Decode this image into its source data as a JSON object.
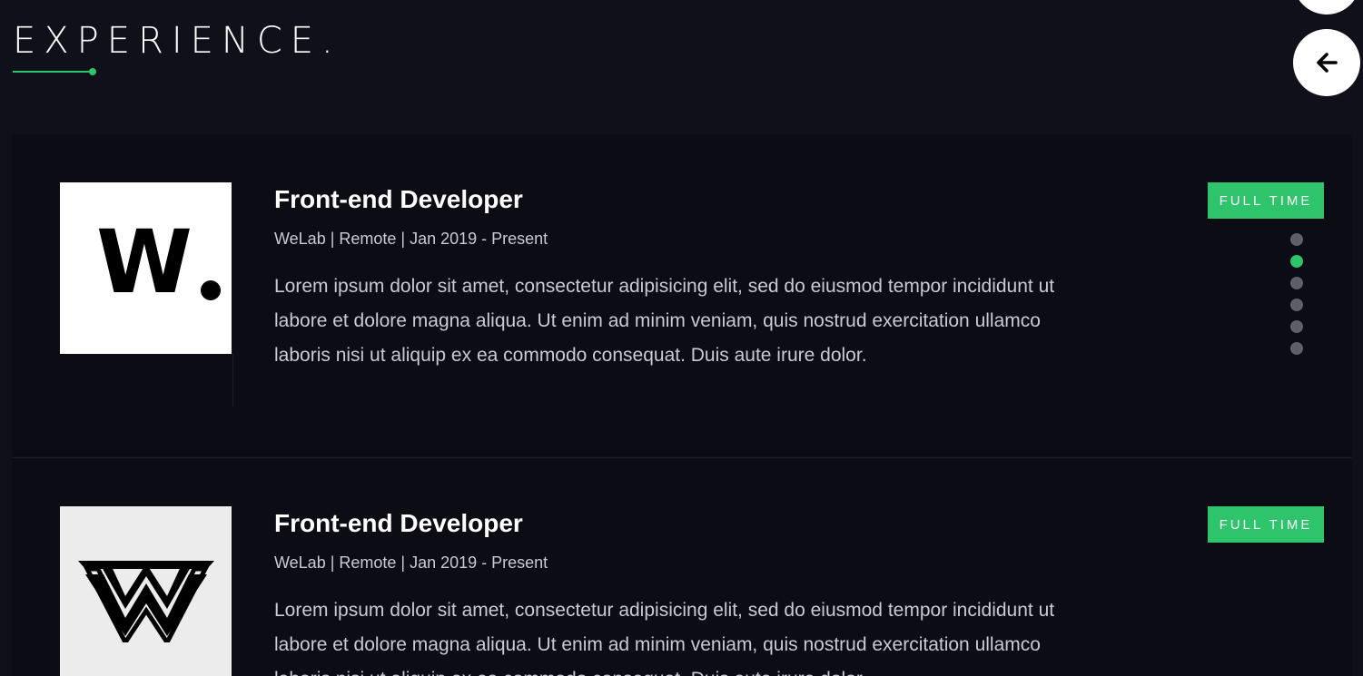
{
  "section": {
    "title": "EXPERIENCE."
  },
  "nav": {
    "top_button_icon": "circle-button",
    "back_button_icon": "arrow-left-icon"
  },
  "experience": [
    {
      "logo_icon": "welab-logo",
      "logo_text": "W",
      "title": "Front-end Developer",
      "meta": "WeLab | Remote | Jan 2019 - Present",
      "description": "Lorem ipsum dolor sit amet, consectetur adipisicing elit, sed do eiusmod tempor incididunt ut labore et dolore magna aliqua. Ut enim ad minim veniam, quis nostrud exercitation ullamco laboris nisi ut aliquip ex ea commodo consequat. Duis aute irure dolor.",
      "badge": "FULL TIME"
    },
    {
      "logo_icon": "wonder-woman-w-logo",
      "title": "Front-end Developer",
      "meta": "WeLab | Remote | Jan 2019 - Present",
      "description": "Lorem ipsum dolor sit amet, consectetur adipisicing elit, sed do eiusmod tempor incididunt ut labore et dolore magna aliqua. Ut enim ad minim veniam, quis nostrud exercitation ullamco laboris nisi ut aliquip ex ea commodo consequat. Duis aute irure dolor.",
      "badge": "FULL TIME"
    }
  ],
  "pager": {
    "count": 6,
    "active_index": 1
  },
  "colors": {
    "accent": "#2ec46b",
    "background": "#0f1019",
    "card": "#0b0c14",
    "text": "#c9cad2",
    "pager_inactive": "#5e5f67"
  }
}
